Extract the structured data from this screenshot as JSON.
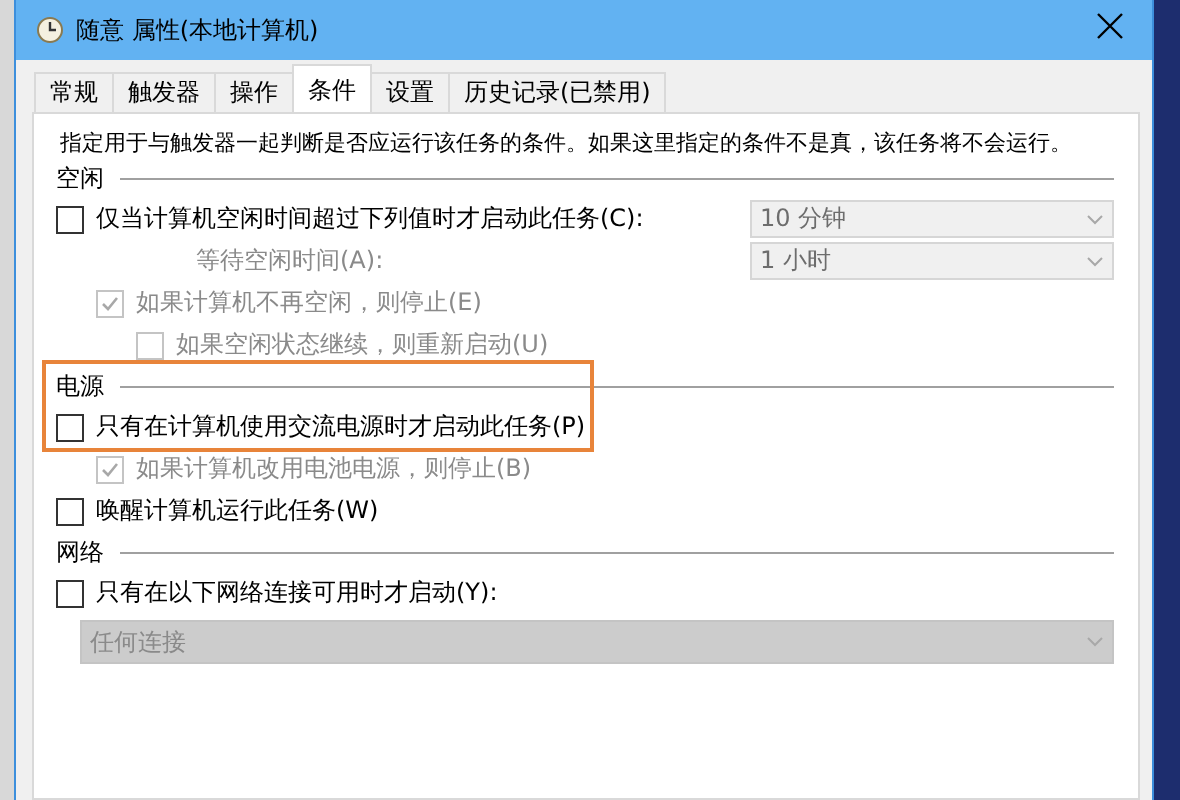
{
  "window": {
    "title": "随意 属性(本地计算机)"
  },
  "tabs": [
    {
      "label": "常规",
      "selected": false
    },
    {
      "label": "触发器",
      "selected": false
    },
    {
      "label": "操作",
      "selected": false
    },
    {
      "label": "条件",
      "selected": true
    },
    {
      "label": "设置",
      "selected": false
    },
    {
      "label": "历史记录(已禁用)",
      "selected": false
    }
  ],
  "description": "指定用于与触发器一起判断是否应运行该任务的条件。如果这里指定的条件不是真，该任务将不会运行。",
  "sections": [
    {
      "title": "空闲",
      "highlighted": false,
      "rows": [
        {
          "kind": "checkbox",
          "label": "仅当计算机空闲时间超过下列值时才启动此任务(C):",
          "checked": false,
          "disabled": false,
          "dropdown": {
            "value": "10 分钟",
            "disabled": true
          },
          "children": [
            {
              "kind": "field",
              "label": "等待空闲时间(A):",
              "disabled": true,
              "dropdown": {
                "value": "1 小时",
                "disabled": true
              }
            },
            {
              "kind": "checkbox",
              "label": "如果计算机不再空闲，则停止(E)",
              "checked": true,
              "disabled": true,
              "children": [
                {
                  "kind": "checkbox",
                  "label": "如果空闲状态继续，则重新启动(U)",
                  "checked": false,
                  "disabled": true
                }
              ]
            }
          ]
        }
      ]
    },
    {
      "title": "电源",
      "highlighted": true,
      "rows": [
        {
          "kind": "checkbox",
          "label": "只有在计算机使用交流电源时才启动此任务(P)",
          "checked": false,
          "disabled": false,
          "children": [
            {
              "kind": "checkbox",
              "label": "如果计算机改用电池电源，则停止(B)",
              "checked": true,
              "disabled": true
            }
          ]
        },
        {
          "kind": "checkbox",
          "label": "唤醒计算机运行此任务(W)",
          "checked": false,
          "disabled": false
        }
      ]
    },
    {
      "title": "网络",
      "highlighted": false,
      "rows": [
        {
          "kind": "checkbox",
          "label": "只有在以下网络连接可用时才启动(Y):",
          "checked": false,
          "disabled": false
        },
        {
          "kind": "wide_dropdown",
          "dropdown": {
            "value": "任何连接",
            "disabled": true
          }
        }
      ]
    }
  ]
}
